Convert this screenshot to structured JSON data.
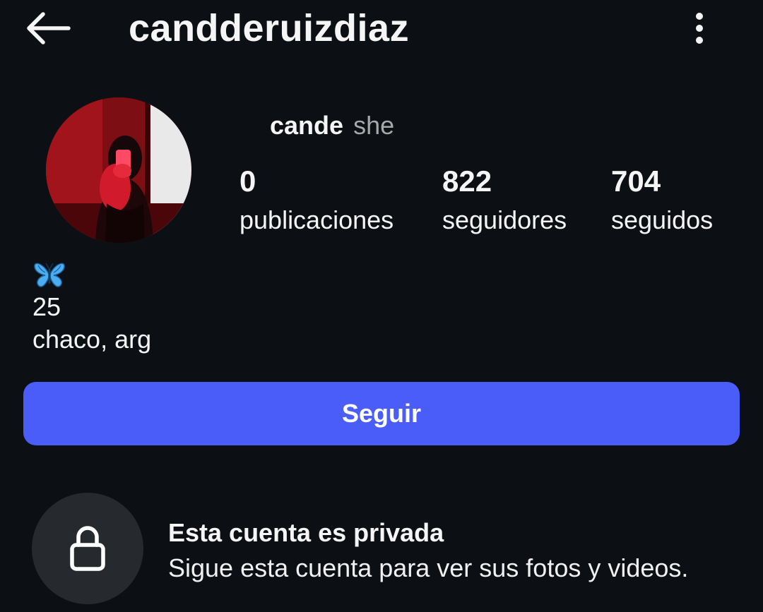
{
  "header": {
    "username": "candderuizdiaz",
    "back_icon": "arrow-left-icon",
    "menu_icon": "more-vertical-icon"
  },
  "profile": {
    "avatar_icon": "profile-photo",
    "display_name": "cande",
    "pronouns": "she"
  },
  "stats": {
    "posts": {
      "count": "0",
      "label": "publicaciones"
    },
    "followers": {
      "count": "822",
      "label": "seguidores"
    },
    "following": {
      "count": "704",
      "label": "seguidos"
    }
  },
  "bio": {
    "emoji_icon": "butterfly-icon",
    "line1": "25",
    "line2": "chaco, arg"
  },
  "actions": {
    "follow_label": "Seguir"
  },
  "private_notice": {
    "icon": "lock-icon",
    "title": "Esta cuenta es privada",
    "subtitle": "Sigue esta cuenta para ver sus fotos y videos."
  },
  "colors": {
    "background": "#0c0f14",
    "accent": "#4a5df9",
    "muted_text": "#a8a8a8",
    "lock_circle": "#26292e"
  }
}
